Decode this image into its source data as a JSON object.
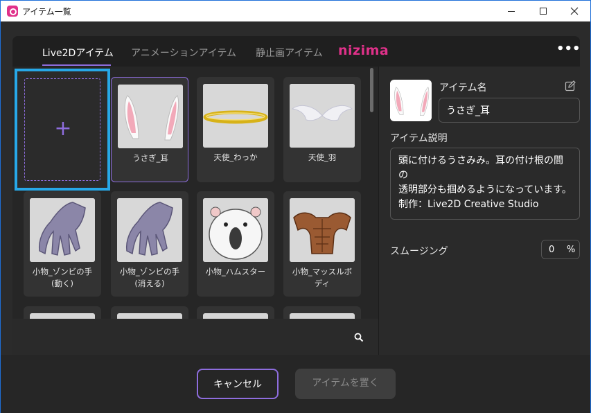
{
  "window": {
    "title": "アイテム一覧",
    "accent_color": "#8e6dde",
    "highlight_color": "#27a8e8"
  },
  "tabs": [
    {
      "label": "Live2Dアイテム",
      "active": true
    },
    {
      "label": "アニメーションアイテム",
      "active": false
    },
    {
      "label": "静止画アイテム",
      "active": false
    }
  ],
  "logo_text": "nizima",
  "more_label": "•••",
  "add_card": {
    "label": "+"
  },
  "items": [
    {
      "label": "うさぎ_耳",
      "icon": "bunny-ears-icon"
    },
    {
      "label": "天使_わっか",
      "icon": "halo-icon"
    },
    {
      "label": "天使_羽",
      "icon": "angel-wings-icon"
    },
    {
      "label": "小物_ゾンビの手\n(動く)",
      "icon": "zombie-hand-icon"
    },
    {
      "label": "小物_ゾンビの手\n(消える)",
      "icon": "zombie-hand-icon"
    },
    {
      "label": "小物_ハムスター",
      "icon": "hamster-icon"
    },
    {
      "label": "小物_マッスルボ\nディ",
      "icon": "muscle-body-icon"
    }
  ],
  "detail": {
    "name_label": "アイテム名",
    "name_value": "うさぎ_耳",
    "desc_label": "アイテム説明",
    "desc_value": "頭に付けるうさみみ。耳の付け根の間の\n透明部分も掴めるようになっています。\n制作：Live2D Creative Studio",
    "smoothing_label": "スムージング",
    "smoothing_value": "0",
    "smoothing_unit": "%"
  },
  "footer": {
    "cancel_label": "キャンセル",
    "place_label": "アイテムを置く"
  }
}
